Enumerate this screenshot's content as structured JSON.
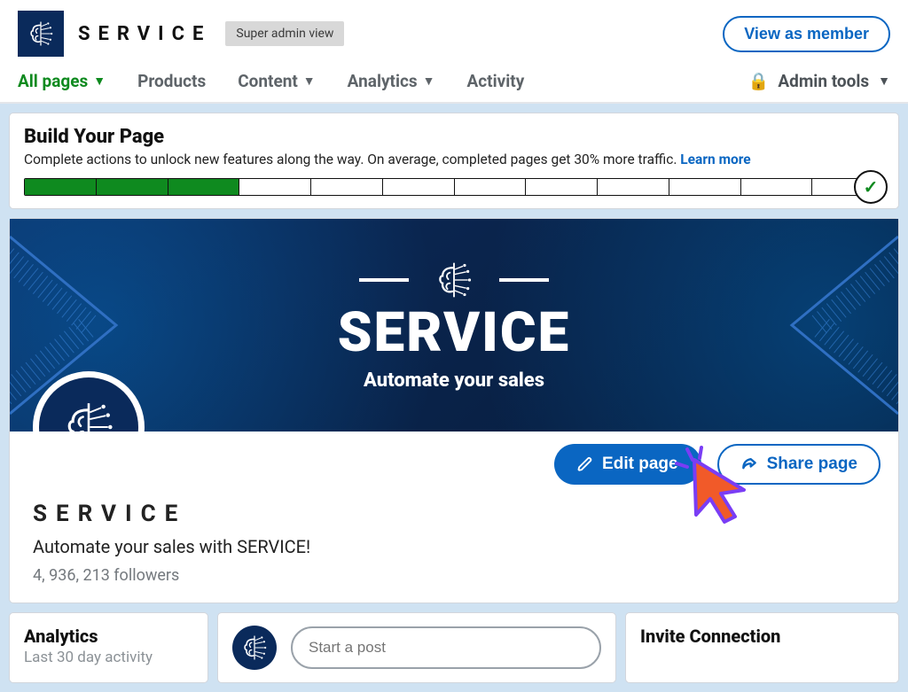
{
  "header": {
    "brand": "SERVICE",
    "badge": "Super admin view",
    "view_as": "View as member"
  },
  "nav": {
    "items": [
      {
        "label": "All pages",
        "active": true,
        "caret": true
      },
      {
        "label": "Products",
        "active": false,
        "caret": false
      },
      {
        "label": "Content",
        "active": false,
        "caret": true
      },
      {
        "label": "Analytics",
        "active": false,
        "caret": true
      },
      {
        "label": "Activity",
        "active": false,
        "caret": false
      }
    ],
    "admin_tools": "Admin tools"
  },
  "build": {
    "title": "Build Your Page",
    "subtitle": "Complete actions to unlock new features along the way. On average, completed pages get 30% more traffic. ",
    "learn_more": "Learn more",
    "segments": 12,
    "completed": 3
  },
  "hero": {
    "title": "SERVICE",
    "subtitle": "Automate your sales"
  },
  "actions": {
    "edit": "Edit page",
    "share": "Share page"
  },
  "company": {
    "name": "SERVICE",
    "tagline": "Automate your sales with SERVICE!",
    "followers": "4, 936, 213 followers"
  },
  "panels": {
    "analytics_title": "Analytics",
    "analytics_sub": "Last 30 day activity",
    "post_placeholder": "Start a post",
    "invite_title": "Invite Connection"
  }
}
